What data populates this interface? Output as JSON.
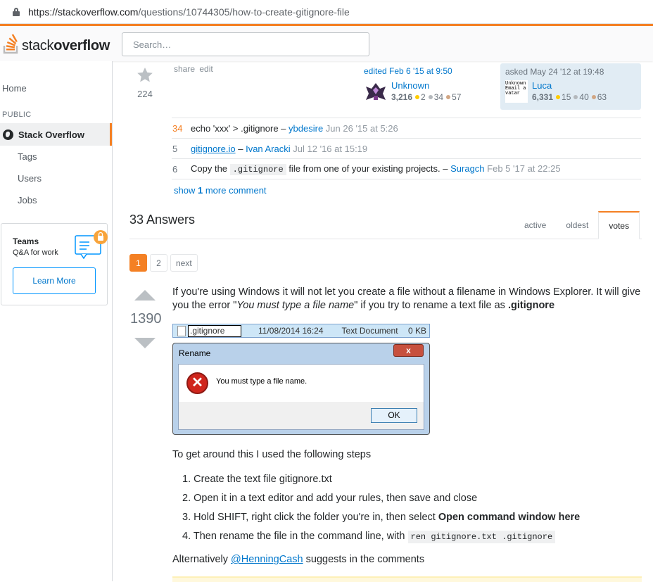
{
  "browser": {
    "url_host": "https://stackoverflow.com",
    "url_path": "/questions/10744305/how-to-create-gitignore-file"
  },
  "header": {
    "logo_text_light": "stack",
    "logo_text_bold": "overflow",
    "search_placeholder": "Search…"
  },
  "sidebar": {
    "home": "Home",
    "public": "PUBLIC",
    "stack_overflow": "Stack Overflow",
    "tags": "Tags",
    "users": "Users",
    "jobs": "Jobs",
    "teams_title": "Teams",
    "teams_sub": "Q&A for work",
    "teams_button": "Learn More"
  },
  "question": {
    "votes": "224",
    "share": "share",
    "edit": "edit",
    "edited_label": "edited Feb 6 '15 at 9:50",
    "editor": {
      "name": "Unknown",
      "rep": "3,216",
      "gold": "2",
      "silver": "34",
      "bronze": "57"
    },
    "asked_label": "asked May 24 '12 at 19:48",
    "asker": {
      "name": "Luca",
      "rep": "6,331",
      "gold": "15",
      "silver": "40",
      "bronze": "63",
      "avatar_text": "Unknown Email avatar"
    }
  },
  "comments": [
    {
      "score": "34",
      "text": "echo 'xxx' > .gitignore",
      "user": "ybdesire",
      "date": "Jun 26 '15 at 5:26"
    },
    {
      "score": "5",
      "link": "gitignore.io",
      "user": "Ivan Aracki",
      "date": "Jul 12 '16 at 15:19"
    },
    {
      "score": "6",
      "pre": "Copy the",
      "code": ".gitignore",
      "post": "file from one of your existing projects.",
      "user": "Suragch",
      "date": "Feb 5 '17 at 22:25"
    }
  ],
  "show_more": {
    "pre": "show",
    "num": "1",
    "post": "more comment"
  },
  "answers": {
    "heading": "33 Answers",
    "tabs": [
      "active",
      "oldest",
      "votes"
    ],
    "pager": [
      "1",
      "2",
      "next"
    ]
  },
  "answer": {
    "votes": "1390",
    "p1_a": "If you're using Windows it will not let you create a file without a filename in Windows Explorer. It will give you the error \"",
    "p1_i": "You must type a file name",
    "p1_b": "\" if you try to rename a text file as ",
    "p1_bold": ".gitignore",
    "explorer": {
      "name": ".gitignore",
      "date": "11/08/2014 16:24",
      "type": "Text Document",
      "size": "0 KB"
    },
    "dialog": {
      "title": "Rename",
      "close": "x",
      "message": "You must type a file name.",
      "ok": "OK"
    },
    "p2": "To get around this I used the following steps",
    "steps": {
      "s1": "Create the text file gitignore.txt",
      "s2": "Open it in a text editor and add your rules, then save and close",
      "s3_pre": "Hold SHIFT, right click the folder you're in, then select ",
      "s3_bold": "Open command window here",
      "s4_pre": "Then rename the file in the command line, with ",
      "s4_code": "ren gitignore.txt .gitignore"
    },
    "p3_pre": "Alternatively ",
    "p3_link": "@HenningCash",
    "p3_post": " suggests in the comments"
  },
  "colors": {
    "accent": "#f48024",
    "link": "#0077cc"
  }
}
